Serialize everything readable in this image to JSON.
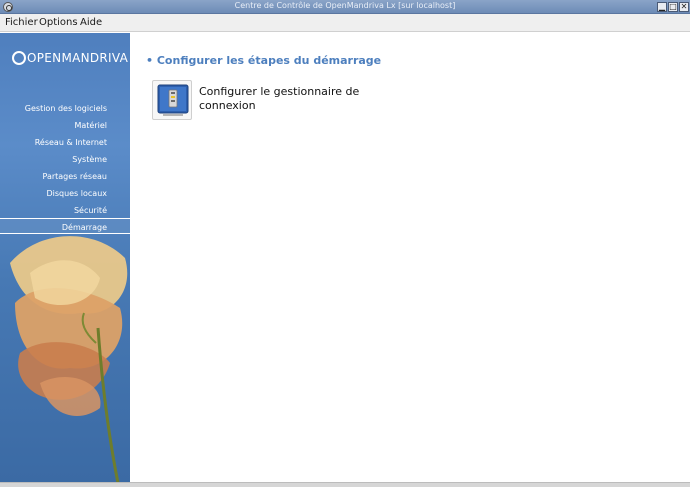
{
  "window": {
    "title": "Centre de Contrôle de OpenMandriva Lx  [sur localhost]"
  },
  "menu": [
    "Fichier",
    "Options",
    "Aide"
  ],
  "sidebar": {
    "logo": "OPENMANDRIVA",
    "items": [
      {
        "label": "Gestion des logiciels"
      },
      {
        "label": "Matériel"
      },
      {
        "label": "Réseau & Internet"
      },
      {
        "label": "Système"
      },
      {
        "label": "Partages réseau"
      },
      {
        "label": "Disques locaux"
      },
      {
        "label": "Sécurité"
      },
      {
        "label": "Démarrage",
        "active": true
      }
    ]
  },
  "main": {
    "section_title": "• Configurer les étapes du démarrage",
    "tools": [
      {
        "label": "Configurer le gestionnaire de connexion",
        "icon": "login-manager-icon"
      }
    ]
  },
  "colors": {
    "accent": "#4d7fbe",
    "sidebar": "#4f7fbe"
  }
}
